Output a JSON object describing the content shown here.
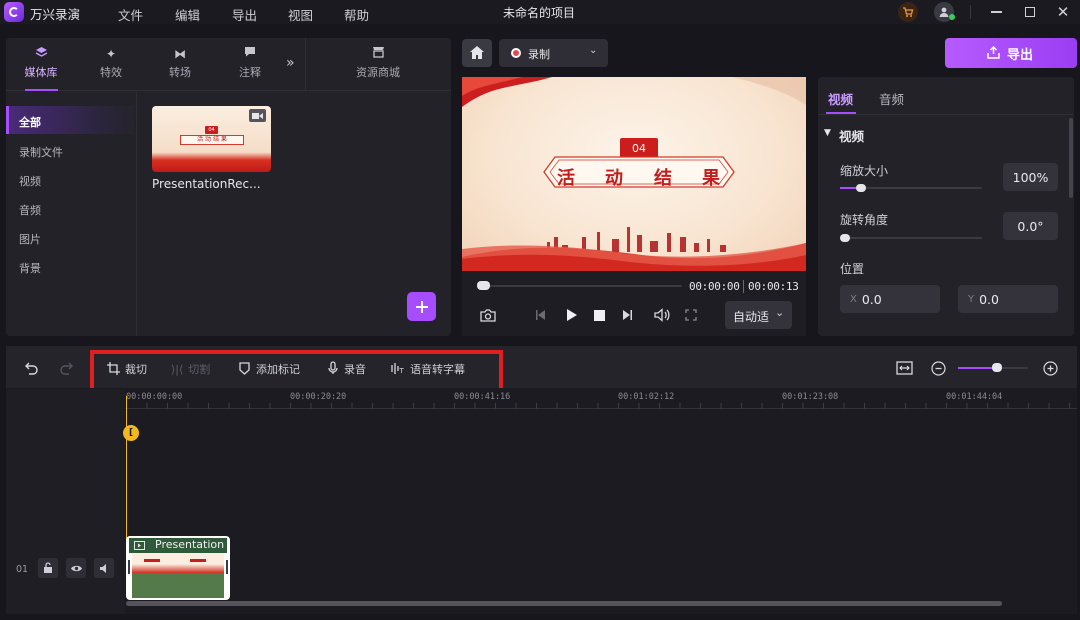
{
  "app": {
    "name": "万兴录演",
    "project_title": "未命名的项目"
  },
  "menu": [
    "文件",
    "编辑",
    "导出",
    "视图",
    "帮助"
  ],
  "export_button": "导出",
  "record_button": "录制",
  "media_tabs": [
    {
      "label": "媒体库",
      "icon": "layers-icon",
      "active": true
    },
    {
      "label": "特效",
      "icon": "sparkle-icon"
    },
    {
      "label": "转场",
      "icon": "transition-icon"
    },
    {
      "label": "注释",
      "icon": "comment-icon"
    }
  ],
  "store_tab": "资源商城",
  "categories": [
    "全部",
    "录制文件",
    "视频",
    "音频",
    "图片",
    "背景"
  ],
  "media_items": [
    {
      "name": "PresentationRec...",
      "thumb_badge": "04",
      "thumb_text": "活 动 结 果"
    }
  ],
  "preview": {
    "badge": "04",
    "title_chars": [
      "活",
      "动",
      "结",
      "果"
    ],
    "current_time": "00:00:00",
    "total_time": "00:00:13",
    "fit_mode": "自动适"
  },
  "properties": {
    "tabs": [
      "视频",
      "音频"
    ],
    "active_tab": "视频",
    "section": "视频",
    "scale_label": "缩放大小",
    "scale_value": "100%",
    "scale_level": 0.15,
    "rotate_label": "旋转角度",
    "rotate_value": "0.0°",
    "rotate_level": 0.0,
    "position_label": "位置",
    "x_label": "X",
    "x_value": "0.0",
    "y_label": "Y",
    "y_value": "0.0"
  },
  "timeline_tools": [
    "裁切",
    "切割",
    "添加标记",
    "录音",
    "语音转字幕"
  ],
  "timeline_ticks": [
    "00:00:00:00",
    "00:00:20:20",
    "00:00:41:16",
    "00:01:02:12",
    "00:01:23:08",
    "00:01:44:04"
  ],
  "zoom_level": 0.55,
  "track": {
    "number": "01",
    "clip_label": "Presentation"
  },
  "colors": {
    "accent": "#a64dff",
    "record_red": "#e5484d",
    "highlight_box": "#e02020",
    "playhead": "#f2b81c"
  }
}
